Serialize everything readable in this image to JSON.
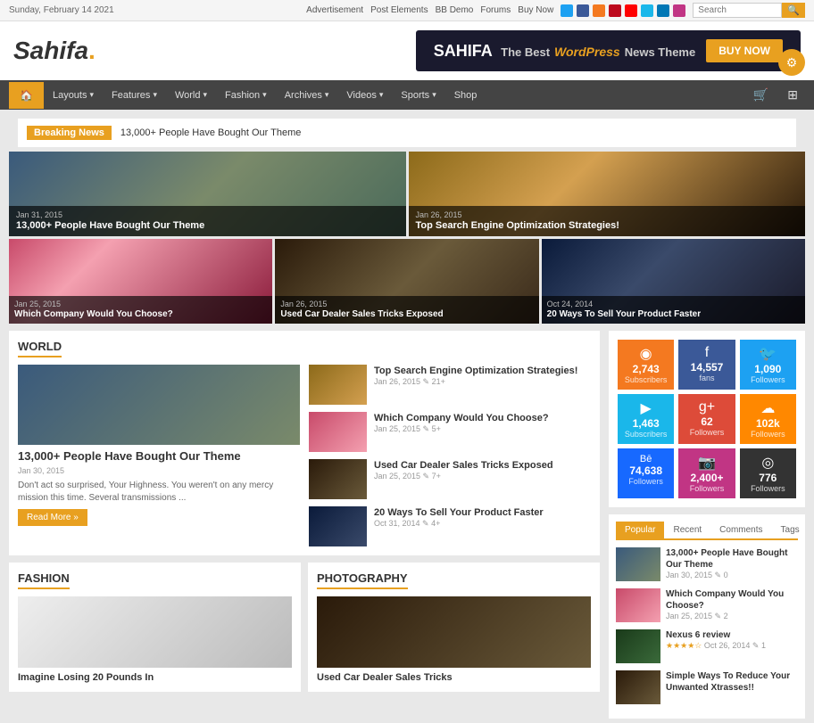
{
  "topbar": {
    "date": "Sunday, February 14 2021",
    "links": [
      "Advertisement",
      "Post Elements",
      "BB Demo",
      "Forums",
      "Buy Now"
    ],
    "search_placeholder": "Search"
  },
  "header": {
    "logo_text": "Sahifa",
    "logo_dot": ".",
    "ad_title": "SAHIFA",
    "ad_subtitle": "The Best",
    "ad_brand": "WordPress",
    "ad_rest": "News Theme",
    "buy_now": "BUY NOW"
  },
  "nav": {
    "home_icon": "🏠",
    "items": [
      {
        "label": "Layouts",
        "has_arrow": true
      },
      {
        "label": "Features",
        "has_arrow": true
      },
      {
        "label": "World",
        "has_arrow": true
      },
      {
        "label": "Fashion",
        "has_arrow": true
      },
      {
        "label": "Archives",
        "has_arrow": true
      },
      {
        "label": "Videos",
        "has_arrow": true
      },
      {
        "label": "Sports",
        "has_arrow": true
      },
      {
        "label": "Shop"
      }
    ]
  },
  "breaking_news": {
    "label": "Breaking News",
    "text": "13,000+ People Have Bought Our Theme"
  },
  "hero": {
    "top_left": {
      "date": "Jan 31, 2015",
      "title": "13,000+ People Have Bought Our Theme"
    },
    "top_right": {
      "date": "Jan 26, 2015",
      "title": "Top Search Engine Optimization Strategies!"
    },
    "bottom_left": {
      "date": "Jan 25, 2015",
      "title": "Which Company Would You Choose?"
    },
    "bottom_mid": {
      "date": "Jan 26, 2015",
      "title": "Used Car Dealer Sales Tricks Exposed"
    },
    "bottom_right": {
      "date": "Oct 24, 2014",
      "title": "20 Ways To Sell Your Product Faster"
    }
  },
  "world_section": {
    "title": "World",
    "featured": {
      "title": "13,000+ People Have Bought Our Theme",
      "date": "Jan 30, 2015",
      "description": "Don't act so surprised, Your Highness. You weren't on any mercy mission this time. Several transmissions ...",
      "read_more": "Read More »"
    },
    "list": [
      {
        "title": "Top Search Engine Optimization Strategies!",
        "date": "Jan 26, 2015",
        "comments": "21+"
      },
      {
        "title": "Which Company Would You Choose?",
        "date": "Jan 25, 2015",
        "comments": "5+"
      },
      {
        "title": "Used Car Dealer Sales Tricks Exposed",
        "date": "Jan 25, 2015",
        "comments": "7+"
      },
      {
        "title": "20 Ways To Sell Your Product Faster",
        "date": "Oct 31, 2014",
        "comments": "4+"
      }
    ]
  },
  "fashion_section": {
    "title": "Fashion",
    "item1_title": "Imagine Losing 20 Pounds In"
  },
  "photography_section": {
    "title": "Photography",
    "item1_title": "Used Car Dealer Sales Tricks"
  },
  "social": {
    "items": [
      {
        "platform": "rss",
        "icon": "◉",
        "count": "2,743",
        "label": "Subscribers",
        "color": "#f47920"
      },
      {
        "platform": "facebook",
        "icon": "f",
        "count": "14,557",
        "label": "fans",
        "color": "#3b5998"
      },
      {
        "platform": "twitter",
        "icon": "🐦",
        "count": "1,090",
        "label": "Followers",
        "color": "#1da1f2"
      },
      {
        "platform": "vimeo",
        "icon": "▶",
        "count": "1,463",
        "label": "Subscribers",
        "color": "#1ab7ea"
      },
      {
        "platform": "googleplus",
        "icon": "g+",
        "count": "62",
        "label": "Followers",
        "color": "#dd4b39"
      },
      {
        "platform": "soundcloud",
        "icon": "☁",
        "count": "102k",
        "label": "Followers",
        "color": "#f90"
      },
      {
        "platform": "behance",
        "icon": "Bē",
        "count": "74,638",
        "label": "Followers",
        "color": "#1769ff"
      },
      {
        "platform": "instagram",
        "icon": "📷",
        "count": "2,400+",
        "label": "Followers",
        "color": "#c13584"
      },
      {
        "platform": "github",
        "icon": "◎",
        "count": "776",
        "label": "Followers",
        "color": "#333"
      }
    ]
  },
  "tabs": {
    "buttons": [
      "Popular",
      "Recent",
      "Comments",
      "Tags"
    ],
    "active": "Popular",
    "items": [
      {
        "title": "13,000+ People Have Bought Our Theme",
        "date": "Jan 30, 2015",
        "comments": "0"
      },
      {
        "title": "Which Company Would You Choose?",
        "date": "Jan 25, 2015",
        "comments": "2"
      },
      {
        "title": "Nexus 6 review",
        "date": "Oct 26, 2014",
        "comments": "1",
        "rating": "★★★★☆"
      },
      {
        "title": "Simple Ways To Reduce Your Unwanted Xtrasses!!",
        "date": "",
        "comments": ""
      }
    ]
  }
}
